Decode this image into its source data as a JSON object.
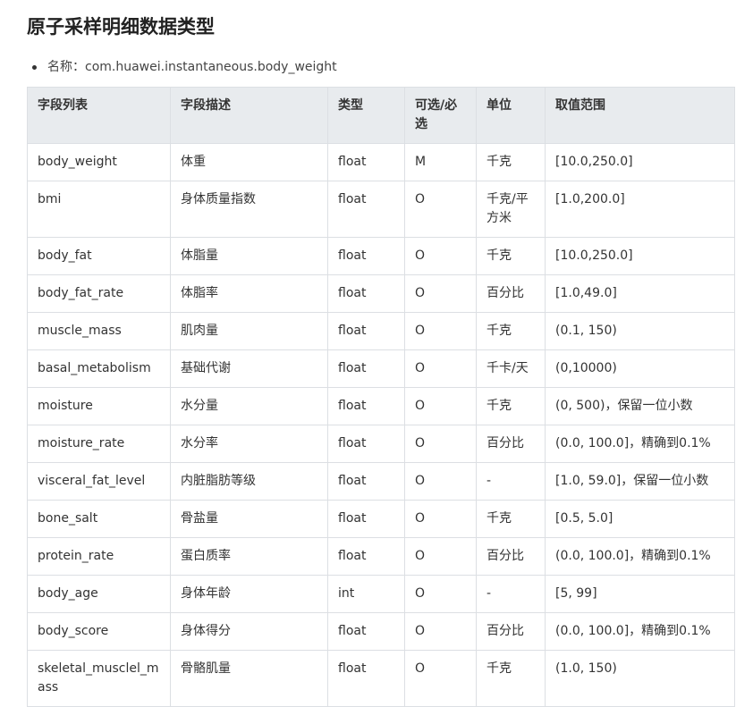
{
  "title": "原子采样明细数据类型",
  "name_item": "名称：com.huawei.instantaneous.body_weight",
  "headers": [
    "字段列表",
    "字段描述",
    "类型",
    "可选/必选",
    "单位",
    "取值范围"
  ],
  "rows": [
    [
      "body_weight",
      "体重",
      "float",
      "M",
      "千克",
      "[10.0,250.0]"
    ],
    [
      "bmi",
      "身体质量指数",
      "float",
      "O",
      "千克/平方米",
      "[1.0,200.0]"
    ],
    [
      "body_fat",
      "体脂量",
      "float",
      "O",
      "千克",
      "[10.0,250.0]"
    ],
    [
      "body_fat_rate",
      "体脂率",
      "float",
      "O",
      "百分比",
      "[1.0,49.0]"
    ],
    [
      "muscle_mass",
      "肌肉量",
      "float",
      "O",
      "千克",
      "(0.1, 150)"
    ],
    [
      "basal_metabolism",
      "基础代谢",
      "float",
      "O",
      "千卡/天",
      "(0,10000)"
    ],
    [
      "moisture",
      "水分量",
      "float",
      "O",
      "千克",
      "(0, 500)，保留一位小数"
    ],
    [
      "moisture_rate",
      "水分率",
      "float",
      "O",
      "百分比",
      "(0.0, 100.0]，精确到0.1%"
    ],
    [
      "visceral_fat_level",
      "内脏脂肪等级",
      "float",
      "O",
      "-",
      "[1.0, 59.0]，保留一位小数"
    ],
    [
      "bone_salt",
      "骨盐量",
      "float",
      "O",
      "千克",
      "[0.5, 5.0]"
    ],
    [
      "protein_rate",
      "蛋白质率",
      "float",
      "O",
      "百分比",
      "(0.0, 100.0]，精确到0.1%"
    ],
    [
      "body_age",
      "身体年龄",
      "int",
      "O",
      "-",
      "[5, 99]"
    ],
    [
      "body_score",
      "身体得分",
      "float",
      "O",
      "百分比",
      "(0.0, 100.0]，精确到0.1%"
    ],
    [
      "skeletal_musclel_mass",
      "骨骼肌量",
      "float",
      "O",
      "千克",
      "(1.0, 150)"
    ]
  ]
}
